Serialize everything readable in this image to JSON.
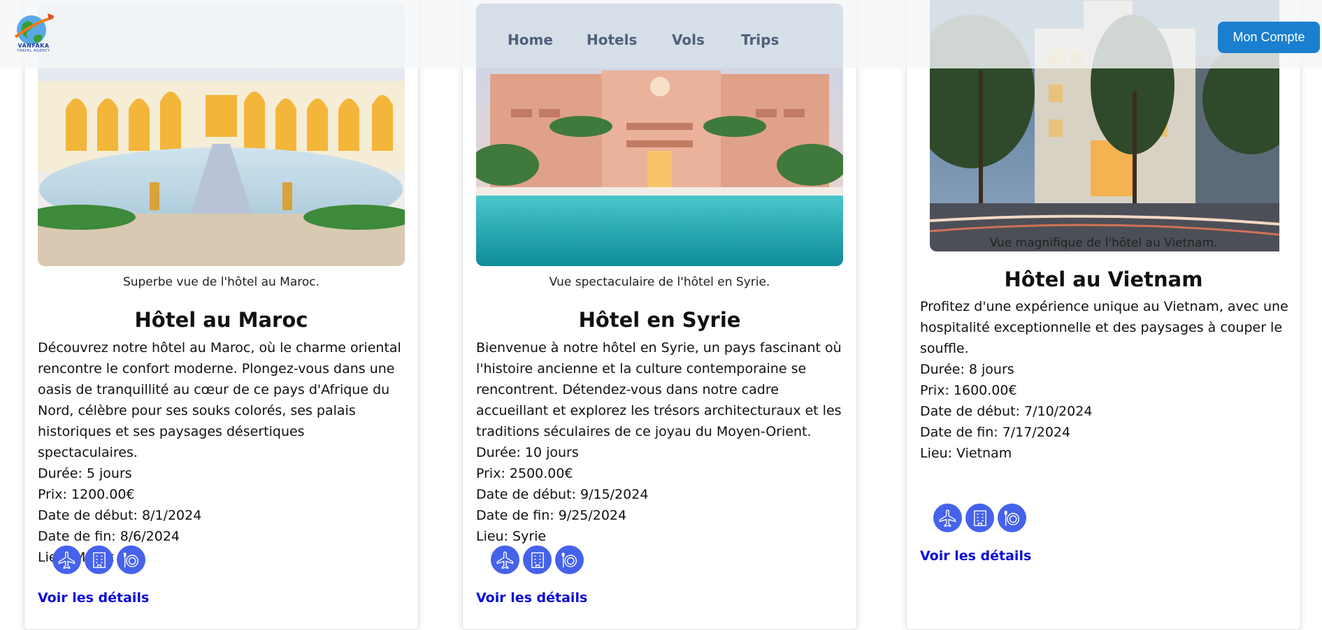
{
  "nav": {
    "logo": {
      "line1": "VANFAKA",
      "line2": "TRAVEL AGENCY"
    },
    "links": [
      "Home",
      "Hotels",
      "Vols",
      "Trips"
    ],
    "account_label": "Mon Compte"
  },
  "cards": [
    {
      "caption": "Superbe vue de l'hôtel au Maroc.",
      "title": "Hôtel au Maroc",
      "description": "Découvrez notre hôtel au Maroc, où le charme oriental rencontre le confort moderne. Plongez-vous dans une oasis de tranquillité au cœur de ce pays d'Afrique du Nord, célèbre pour ses souks colorés, ses palais historiques et ses paysages désertiques spectaculaires.",
      "duration": "Durée: 5 jours",
      "price": "Prix: 1200.00€",
      "start": "Date de début: 8/1/2024",
      "end": "Date de fin: 8/6/2024",
      "place": "Lieu: Maroc",
      "details_label": "Voir les détails"
    },
    {
      "caption": "Vue spectaculaire de l'hôtel en Syrie.",
      "title": "Hôtel en Syrie",
      "description": "Bienvenue à notre hôtel en Syrie, un pays fascinant où l'histoire ancienne et la culture contemporaine se rencontrent. Détendez-vous dans notre cadre accueillant et explorez les trésors architecturaux et les traditions séculaires de ce joyau du Moyen-Orient.",
      "duration": "Durée: 10 jours",
      "price": "Prix: 2500.00€",
      "start": "Date de début: 9/15/2024",
      "end": "Date de fin: 9/25/2024",
      "place": "Lieu: Syrie",
      "details_label": "Voir les détails"
    },
    {
      "caption": "Vue magnifique de l'hôtel au Vietnam.",
      "title": "Hôtel au Vietnam",
      "description": "Profitez d'une expérience unique au Vietnam, avec une hospitalité exceptionnelle et des paysages à couper le souffle.",
      "duration": "Durée: 8 jours",
      "price": "Prix: 1600.00€",
      "start": "Date de début: 7/10/2024",
      "end": "Date de fin: 7/17/2024",
      "place": "Lieu: Vietnam",
      "details_label": "Voir les détails"
    }
  ],
  "icons": [
    "plane-icon",
    "hotel-icon",
    "food-icon"
  ],
  "colors": {
    "icon_bg": "#4562ea",
    "link": "#0b0bd8",
    "account_bg": "#1b7fcf",
    "nav_text": "#50607a"
  }
}
